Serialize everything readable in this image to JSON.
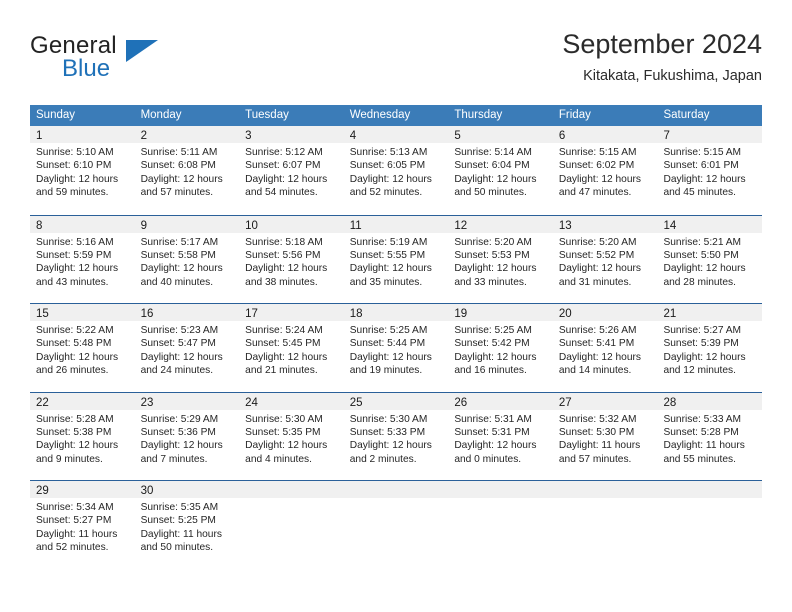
{
  "brand": {
    "word1": "General",
    "word2": "Blue",
    "accent_color": "#1f71b8"
  },
  "header": {
    "month_title": "September 2024",
    "location": "Kitakata, Fukushima, Japan"
  },
  "calendar": {
    "header_bg": "#3b7cb8",
    "row_border_color": "#2a6099",
    "daynum_band_bg": "#f0f0f0",
    "weekdays": [
      "Sunday",
      "Monday",
      "Tuesday",
      "Wednesday",
      "Thursday",
      "Friday",
      "Saturday"
    ],
    "weeks": [
      [
        {
          "day": "1",
          "sunrise": "Sunrise: 5:10 AM",
          "sunset": "Sunset: 6:10 PM",
          "daylight_line1": "Daylight: 12 hours",
          "daylight_line2": "and 59 minutes."
        },
        {
          "day": "2",
          "sunrise": "Sunrise: 5:11 AM",
          "sunset": "Sunset: 6:08 PM",
          "daylight_line1": "Daylight: 12 hours",
          "daylight_line2": "and 57 minutes."
        },
        {
          "day": "3",
          "sunrise": "Sunrise: 5:12 AM",
          "sunset": "Sunset: 6:07 PM",
          "daylight_line1": "Daylight: 12 hours",
          "daylight_line2": "and 54 minutes."
        },
        {
          "day": "4",
          "sunrise": "Sunrise: 5:13 AM",
          "sunset": "Sunset: 6:05 PM",
          "daylight_line1": "Daylight: 12 hours",
          "daylight_line2": "and 52 minutes."
        },
        {
          "day": "5",
          "sunrise": "Sunrise: 5:14 AM",
          "sunset": "Sunset: 6:04 PM",
          "daylight_line1": "Daylight: 12 hours",
          "daylight_line2": "and 50 minutes."
        },
        {
          "day": "6",
          "sunrise": "Sunrise: 5:15 AM",
          "sunset": "Sunset: 6:02 PM",
          "daylight_line1": "Daylight: 12 hours",
          "daylight_line2": "and 47 minutes."
        },
        {
          "day": "7",
          "sunrise": "Sunrise: 5:15 AM",
          "sunset": "Sunset: 6:01 PM",
          "daylight_line1": "Daylight: 12 hours",
          "daylight_line2": "and 45 minutes."
        }
      ],
      [
        {
          "day": "8",
          "sunrise": "Sunrise: 5:16 AM",
          "sunset": "Sunset: 5:59 PM",
          "daylight_line1": "Daylight: 12 hours",
          "daylight_line2": "and 43 minutes."
        },
        {
          "day": "9",
          "sunrise": "Sunrise: 5:17 AM",
          "sunset": "Sunset: 5:58 PM",
          "daylight_line1": "Daylight: 12 hours",
          "daylight_line2": "and 40 minutes."
        },
        {
          "day": "10",
          "sunrise": "Sunrise: 5:18 AM",
          "sunset": "Sunset: 5:56 PM",
          "daylight_line1": "Daylight: 12 hours",
          "daylight_line2": "and 38 minutes."
        },
        {
          "day": "11",
          "sunrise": "Sunrise: 5:19 AM",
          "sunset": "Sunset: 5:55 PM",
          "daylight_line1": "Daylight: 12 hours",
          "daylight_line2": "and 35 minutes."
        },
        {
          "day": "12",
          "sunrise": "Sunrise: 5:20 AM",
          "sunset": "Sunset: 5:53 PM",
          "daylight_line1": "Daylight: 12 hours",
          "daylight_line2": "and 33 minutes."
        },
        {
          "day": "13",
          "sunrise": "Sunrise: 5:20 AM",
          "sunset": "Sunset: 5:52 PM",
          "daylight_line1": "Daylight: 12 hours",
          "daylight_line2": "and 31 minutes."
        },
        {
          "day": "14",
          "sunrise": "Sunrise: 5:21 AM",
          "sunset": "Sunset: 5:50 PM",
          "daylight_line1": "Daylight: 12 hours",
          "daylight_line2": "and 28 minutes."
        }
      ],
      [
        {
          "day": "15",
          "sunrise": "Sunrise: 5:22 AM",
          "sunset": "Sunset: 5:48 PM",
          "daylight_line1": "Daylight: 12 hours",
          "daylight_line2": "and 26 minutes."
        },
        {
          "day": "16",
          "sunrise": "Sunrise: 5:23 AM",
          "sunset": "Sunset: 5:47 PM",
          "daylight_line1": "Daylight: 12 hours",
          "daylight_line2": "and 24 minutes."
        },
        {
          "day": "17",
          "sunrise": "Sunrise: 5:24 AM",
          "sunset": "Sunset: 5:45 PM",
          "daylight_line1": "Daylight: 12 hours",
          "daylight_line2": "and 21 minutes."
        },
        {
          "day": "18",
          "sunrise": "Sunrise: 5:25 AM",
          "sunset": "Sunset: 5:44 PM",
          "daylight_line1": "Daylight: 12 hours",
          "daylight_line2": "and 19 minutes."
        },
        {
          "day": "19",
          "sunrise": "Sunrise: 5:25 AM",
          "sunset": "Sunset: 5:42 PM",
          "daylight_line1": "Daylight: 12 hours",
          "daylight_line2": "and 16 minutes."
        },
        {
          "day": "20",
          "sunrise": "Sunrise: 5:26 AM",
          "sunset": "Sunset: 5:41 PM",
          "daylight_line1": "Daylight: 12 hours",
          "daylight_line2": "and 14 minutes."
        },
        {
          "day": "21",
          "sunrise": "Sunrise: 5:27 AM",
          "sunset": "Sunset: 5:39 PM",
          "daylight_line1": "Daylight: 12 hours",
          "daylight_line2": "and 12 minutes."
        }
      ],
      [
        {
          "day": "22",
          "sunrise": "Sunrise: 5:28 AM",
          "sunset": "Sunset: 5:38 PM",
          "daylight_line1": "Daylight: 12 hours",
          "daylight_line2": "and 9 minutes."
        },
        {
          "day": "23",
          "sunrise": "Sunrise: 5:29 AM",
          "sunset": "Sunset: 5:36 PM",
          "daylight_line1": "Daylight: 12 hours",
          "daylight_line2": "and 7 minutes."
        },
        {
          "day": "24",
          "sunrise": "Sunrise: 5:30 AM",
          "sunset": "Sunset: 5:35 PM",
          "daylight_line1": "Daylight: 12 hours",
          "daylight_line2": "and 4 minutes."
        },
        {
          "day": "25",
          "sunrise": "Sunrise: 5:30 AM",
          "sunset": "Sunset: 5:33 PM",
          "daylight_line1": "Daylight: 12 hours",
          "daylight_line2": "and 2 minutes."
        },
        {
          "day": "26",
          "sunrise": "Sunrise: 5:31 AM",
          "sunset": "Sunset: 5:31 PM",
          "daylight_line1": "Daylight: 12 hours",
          "daylight_line2": "and 0 minutes."
        },
        {
          "day": "27",
          "sunrise": "Sunrise: 5:32 AM",
          "sunset": "Sunset: 5:30 PM",
          "daylight_line1": "Daylight: 11 hours",
          "daylight_line2": "and 57 minutes."
        },
        {
          "day": "28",
          "sunrise": "Sunrise: 5:33 AM",
          "sunset": "Sunset: 5:28 PM",
          "daylight_line1": "Daylight: 11 hours",
          "daylight_line2": "and 55 minutes."
        }
      ],
      [
        {
          "day": "29",
          "sunrise": "Sunrise: 5:34 AM",
          "sunset": "Sunset: 5:27 PM",
          "daylight_line1": "Daylight: 11 hours",
          "daylight_line2": "and 52 minutes."
        },
        {
          "day": "30",
          "sunrise": "Sunrise: 5:35 AM",
          "sunset": "Sunset: 5:25 PM",
          "daylight_line1": "Daylight: 11 hours",
          "daylight_line2": "and 50 minutes."
        },
        {
          "day": "",
          "sunrise": "",
          "sunset": "",
          "daylight_line1": "",
          "daylight_line2": ""
        },
        {
          "day": "",
          "sunrise": "",
          "sunset": "",
          "daylight_line1": "",
          "daylight_line2": ""
        },
        {
          "day": "",
          "sunrise": "",
          "sunset": "",
          "daylight_line1": "",
          "daylight_line2": ""
        },
        {
          "day": "",
          "sunrise": "",
          "sunset": "",
          "daylight_line1": "",
          "daylight_line2": ""
        },
        {
          "day": "",
          "sunrise": "",
          "sunset": "",
          "daylight_line1": "",
          "daylight_line2": ""
        }
      ]
    ]
  }
}
